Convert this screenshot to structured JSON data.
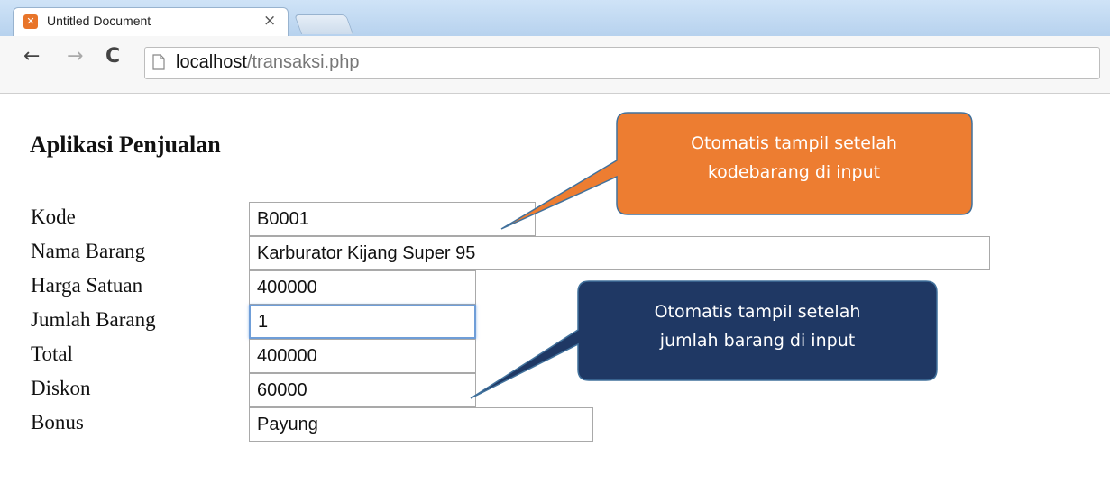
{
  "browser": {
    "tab_title": "Untitled Document",
    "tab_close": "×",
    "favicon": "xampp-icon",
    "url_host": "localhost",
    "url_path": "/transaksi.php",
    "back_icon": "←",
    "forward_icon": "→",
    "reload_icon": "C"
  },
  "page": {
    "heading": "Aplikasi Penjualan",
    "fields": {
      "kode": {
        "label": "Kode",
        "value": "B0001"
      },
      "nama_barang": {
        "label": "Nama Barang",
        "value": "Karburator Kijang Super 95"
      },
      "harga_satuan": {
        "label": "Harga Satuan",
        "value": "400000"
      },
      "jumlah_barang": {
        "label": "Jumlah Barang",
        "value": "1"
      },
      "total": {
        "label": "Total",
        "value": "400000"
      },
      "diskon": {
        "label": "Diskon",
        "value": "60000"
      },
      "bonus": {
        "label": "Bonus",
        "value": "Payung"
      }
    }
  },
  "callouts": {
    "kode": {
      "line1": "Otomatis tampil setelah",
      "line2": "kodebarang di input",
      "fill": "#ed7d31",
      "stroke": "#41719c"
    },
    "jumlah": {
      "line1": "Otomatis tampil setelah",
      "line2": "jumlah barang di input",
      "fill": "#1f3864",
      "stroke": "#41719c"
    }
  }
}
